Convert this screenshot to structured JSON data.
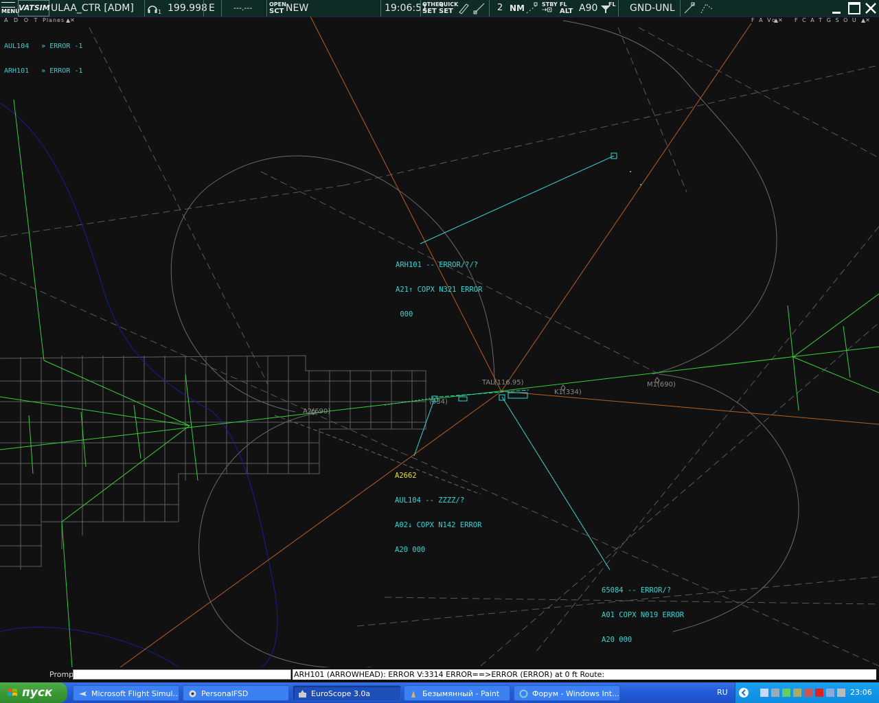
{
  "topbar": {
    "menu_label": "MENU",
    "vatsim_label": "VATSIM",
    "callsign": "ULAA_CTR [ADM]",
    "frequency_sub": "1",
    "frequency": "199.998",
    "atis_letter": "E",
    "atis_code": "---.---",
    "open_label": "OPEN",
    "sct_label": "SCT",
    "sector_status": "NEW",
    "time": "19:06:51",
    "other_label": "OTHER",
    "other_set": "SET",
    "quick_label": "QUICK",
    "quick_set": "SET",
    "range_value": "2",
    "nm_label": "NM",
    "stby_label": "STBY",
    "fl_label": "FL",
    "alt_label": "ALT",
    "altitude_filter": "A90",
    "fl_icon_label": "FL",
    "altitude_range": "GND-UNL",
    "left_sub": "A D O T",
    "left_sub_planes": "Planes",
    "right_sub_1": "F A Vo",
    "right_sub_2": "F C A T G S O U"
  },
  "messages": [
    "AUL104   » ERROR -1",
    "ARH101   » ERROR -1"
  ],
  "targets": [
    {
      "lines": [
        "ARH101 -- ERROR/?/?",
        "A21↑ COPX N321 ERROR",
        " 000"
      ]
    },
    {
      "squawk": "A2662",
      "lines": [
        "AUL104 -- ZZZZ/?",
        "A02↓ COPX N142 ERROR",
        "A20 000"
      ]
    },
    {
      "lines": [
        "65084 -- ERROR/?",
        "A01 COPX N019 ERROR",
        "A20 000"
      ]
    }
  ],
  "waypoints": [
    "TAL(116.95)",
    "K1(334)",
    "M1(690)",
    "A2(690)",
    "(334)"
  ],
  "prompt": {
    "label": "Prompt",
    "value": ""
  },
  "status_message": "ARH101 (ARROWHEAD): ERROR V:3314 ERROR==>ERROR (ERROR) at 0 ft Route:",
  "taskbar": {
    "start_label": "пуск",
    "tasks": [
      "Microsoft Flight Simul...",
      "PersonalFSD",
      "EuroScope 3.0a",
      "Безымянный - Paint",
      "Форум - Windows Int..."
    ],
    "lang": "RU",
    "clock": "23:06"
  },
  "colors": {
    "label": "#2fd6d6",
    "squawk": "#e6e038",
    "airway": "#3cd83c",
    "route": "#c0681c",
    "topbar": "#0e2b26",
    "taskbar": "#245edb"
  }
}
